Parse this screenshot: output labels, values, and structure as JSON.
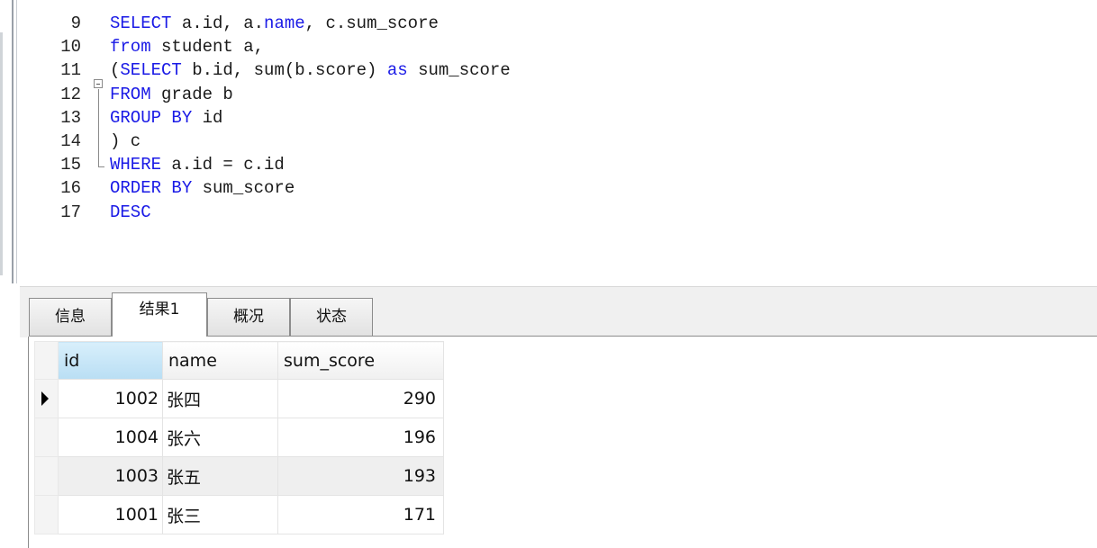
{
  "editor": {
    "lines": [
      {
        "num": "9",
        "tokens": [
          {
            "t": "SELECT",
            "kw": true
          },
          {
            "t": " a.id, a.",
            "kw": false
          },
          {
            "t": "name",
            "kw": true
          },
          {
            "t": ", c.sum_score",
            "kw": false
          }
        ]
      },
      {
        "num": "10",
        "tokens": [
          {
            "t": "from",
            "kw": true
          },
          {
            "t": " student a,",
            "kw": false
          }
        ]
      },
      {
        "num": "11",
        "tokens": [
          {
            "t": "(",
            "kw": false
          },
          {
            "t": "SELECT",
            "kw": true
          },
          {
            "t": " b.id, sum(b.score) ",
            "kw": false
          },
          {
            "t": "as",
            "kw": true
          },
          {
            "t": " sum_score",
            "kw": false
          }
        ]
      },
      {
        "num": "12",
        "tokens": [
          {
            "t": "FROM",
            "kw": true
          },
          {
            "t": " grade b",
            "kw": false
          }
        ]
      },
      {
        "num": "13",
        "tokens": [
          {
            "t": "GROUP BY",
            "kw": true
          },
          {
            "t": " id",
            "kw": false
          }
        ]
      },
      {
        "num": "14",
        "tokens": [
          {
            "t": ") c",
            "kw": false
          }
        ]
      },
      {
        "num": "15",
        "tokens": [
          {
            "t": "WHERE",
            "kw": true
          },
          {
            "t": " a.id = c.id",
            "kw": false
          }
        ]
      },
      {
        "num": "16",
        "tokens": [
          {
            "t": "ORDER BY",
            "kw": true
          },
          {
            "t": " sum_score",
            "kw": false
          }
        ]
      },
      {
        "num": "17",
        "tokens": [
          {
            "t": "DESC",
            "kw": true
          }
        ]
      }
    ]
  },
  "tabs": [
    "信息",
    "结果1",
    "概况",
    "状态"
  ],
  "active_tab": "结果1",
  "result": {
    "columns": [
      "id",
      "name",
      "sum_score"
    ],
    "rows": [
      {
        "id": "1002",
        "name": "张四",
        "sum_score": "290"
      },
      {
        "id": "1004",
        "name": "张六",
        "sum_score": "196"
      },
      {
        "id": "1003",
        "name": "张五",
        "sum_score": "193"
      },
      {
        "id": "1001",
        "name": "张三",
        "sum_score": "171"
      }
    ]
  },
  "colors": {
    "keyword": "#1a1ae6",
    "selected_header": "#b9def4"
  }
}
